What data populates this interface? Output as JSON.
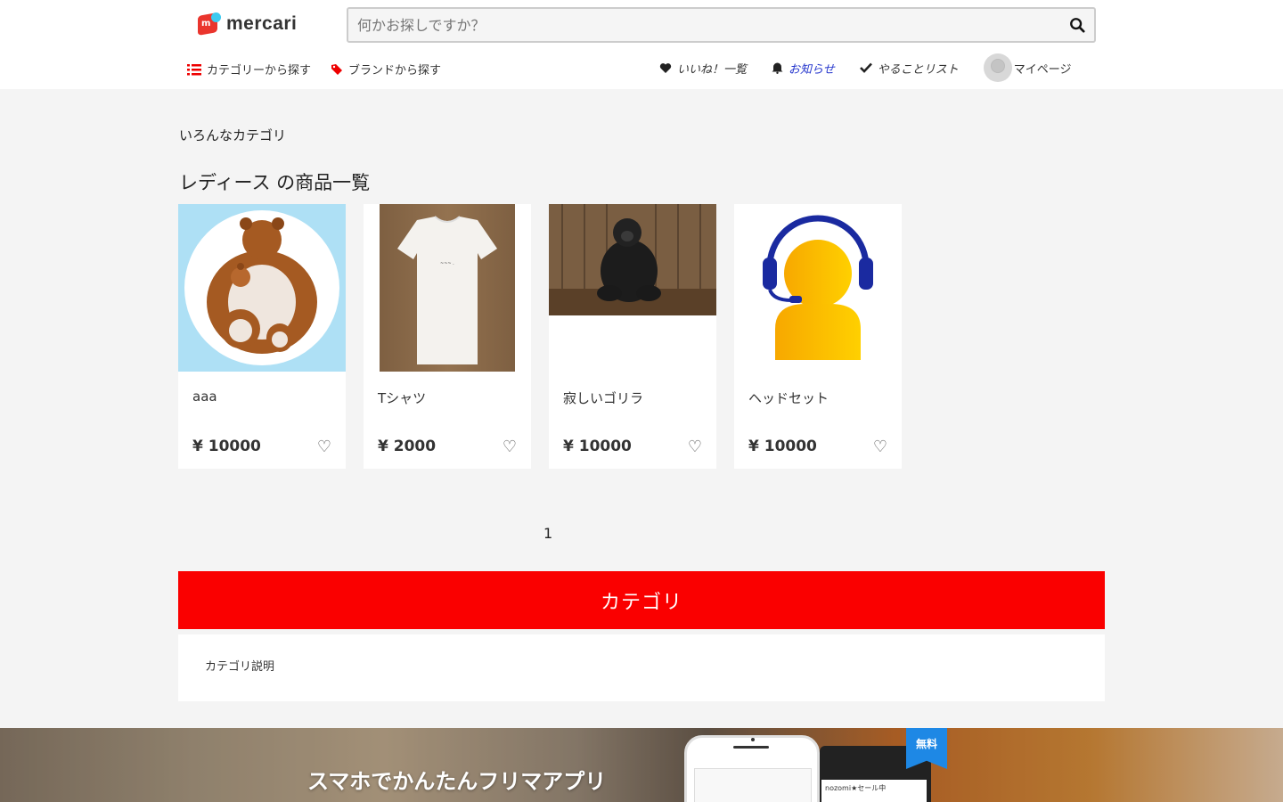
{
  "header": {
    "logo_text": "mercari",
    "logo_mark": "m",
    "search_placeholder": "何かお探しですか？",
    "nav_left": [
      {
        "label": "カテゴリーから探す",
        "icon": "list-icon"
      },
      {
        "label": "ブランドから探す",
        "icon": "tag-icon"
      }
    ],
    "nav_right": {
      "likes": "いいね！一覧",
      "notices": "お知らせ",
      "todo": "やることリスト",
      "mypage": "マイページ"
    }
  },
  "breadcrumb": "いろんなカテゴリ",
  "page_title": "レディース の商品一覧",
  "items": [
    {
      "name": "aaa",
      "price": "¥ 10000",
      "image": "bear-plush"
    },
    {
      "name": "Tシャツ",
      "price": "¥ 2000",
      "image": "white-tshirt"
    },
    {
      "name": "寂しいゴリラ",
      "price": "¥ 10000",
      "image": "gorilla"
    },
    {
      "name": "ヘッドセット",
      "price": "¥ 10000",
      "image": "headset-person"
    }
  ],
  "heart_glyph": "♡",
  "pagination": {
    "current": "1"
  },
  "category_section": {
    "title": "カテゴリ",
    "description": "カテゴリ説明"
  },
  "banner": {
    "headline": "スマホでかんたんフリマアプリ",
    "badge": "無料",
    "tablet_text": "nozomi★セール中"
  },
  "colors": {
    "accent_red": "#fa0000",
    "notice_blue": "#2233cc",
    "badge_blue": "#1e88e5"
  }
}
